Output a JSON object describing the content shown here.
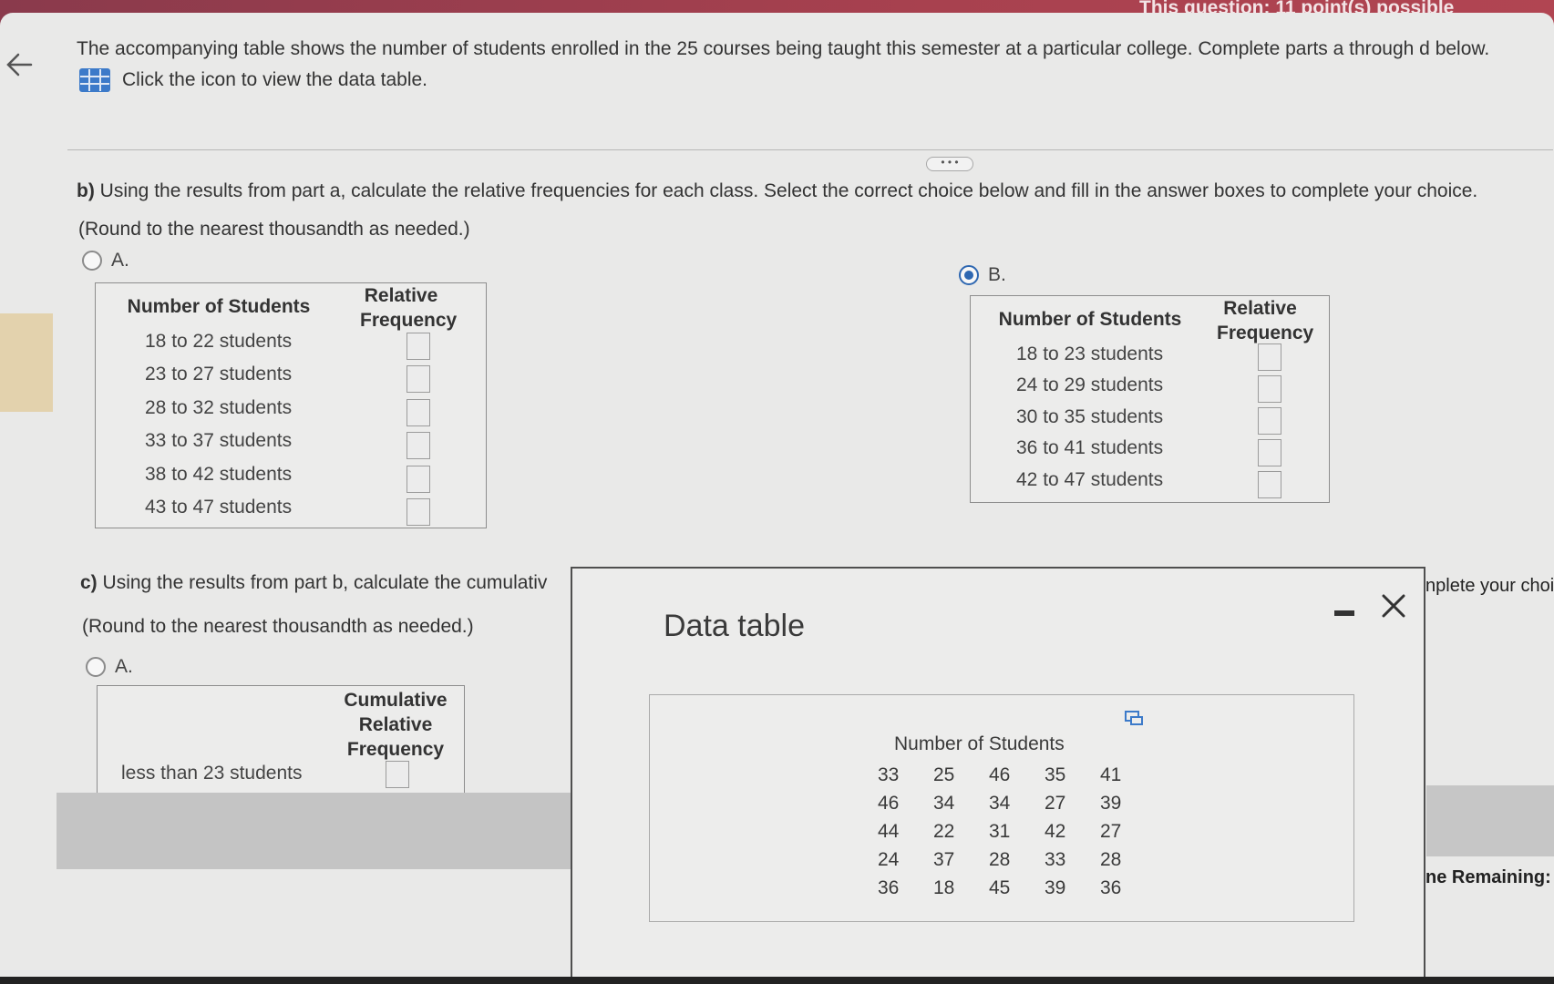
{
  "header": {
    "points_text": "This question: 11 point(s) possible"
  },
  "intro": {
    "text": "The accompanying table shows the number of students enrolled in the 25 courses being taught this semester at a particular college. Complete parts a through d below.",
    "link_text": "Click the icon to view the data table."
  },
  "part_b": {
    "label": "b)",
    "prompt": "Using the results from part a, calculate the relative frequencies for each class. Select the correct choice below and fill in the answer boxes to complete your choice.",
    "round_note": "(Round to the nearest thousandth as needed.)",
    "choice_a": {
      "label": "A.",
      "selected": false,
      "col_header_1": "Number of Students",
      "col_header_2": "Relative Frequency",
      "rows": [
        "18 to 22 students",
        "23 to 27 students",
        "28 to 32 students",
        "33 to 37 students",
        "38 to 42 students",
        "43 to 47 students"
      ]
    },
    "choice_b": {
      "label": "B.",
      "selected": true,
      "col_header_1": "Number of Students",
      "col_header_2": "Relative Frequency",
      "rows": [
        "18 to 23 students",
        "24 to 29 students",
        "30 to 35 students",
        "36 to 41 students",
        "42 to 47 students"
      ]
    }
  },
  "part_c": {
    "label": "c)",
    "prompt_visible": "Using the results from part b, calculate the cumulativ",
    "prompt_right_fragment": "nplete your choi",
    "round_note": "(Round to the nearest thousandth as needed.)",
    "choice_a": {
      "label": "A.",
      "selected": false,
      "col_header": "Cumulative Relative Frequency",
      "rows": [
        "less than 23 students"
      ]
    }
  },
  "time_fragment": "ne Remaining:",
  "modal": {
    "title": "Data table",
    "header": "Number of Students",
    "values": [
      [
        33,
        25,
        46,
        35,
        41
      ],
      [
        46,
        34,
        34,
        27,
        39
      ],
      [
        44,
        22,
        31,
        42,
        27
      ],
      [
        24,
        37,
        28,
        33,
        28
      ],
      [
        36,
        18,
        45,
        39,
        36
      ]
    ]
  },
  "colors": {
    "accent": "#2e67b1",
    "topbar": "#a8414f"
  }
}
